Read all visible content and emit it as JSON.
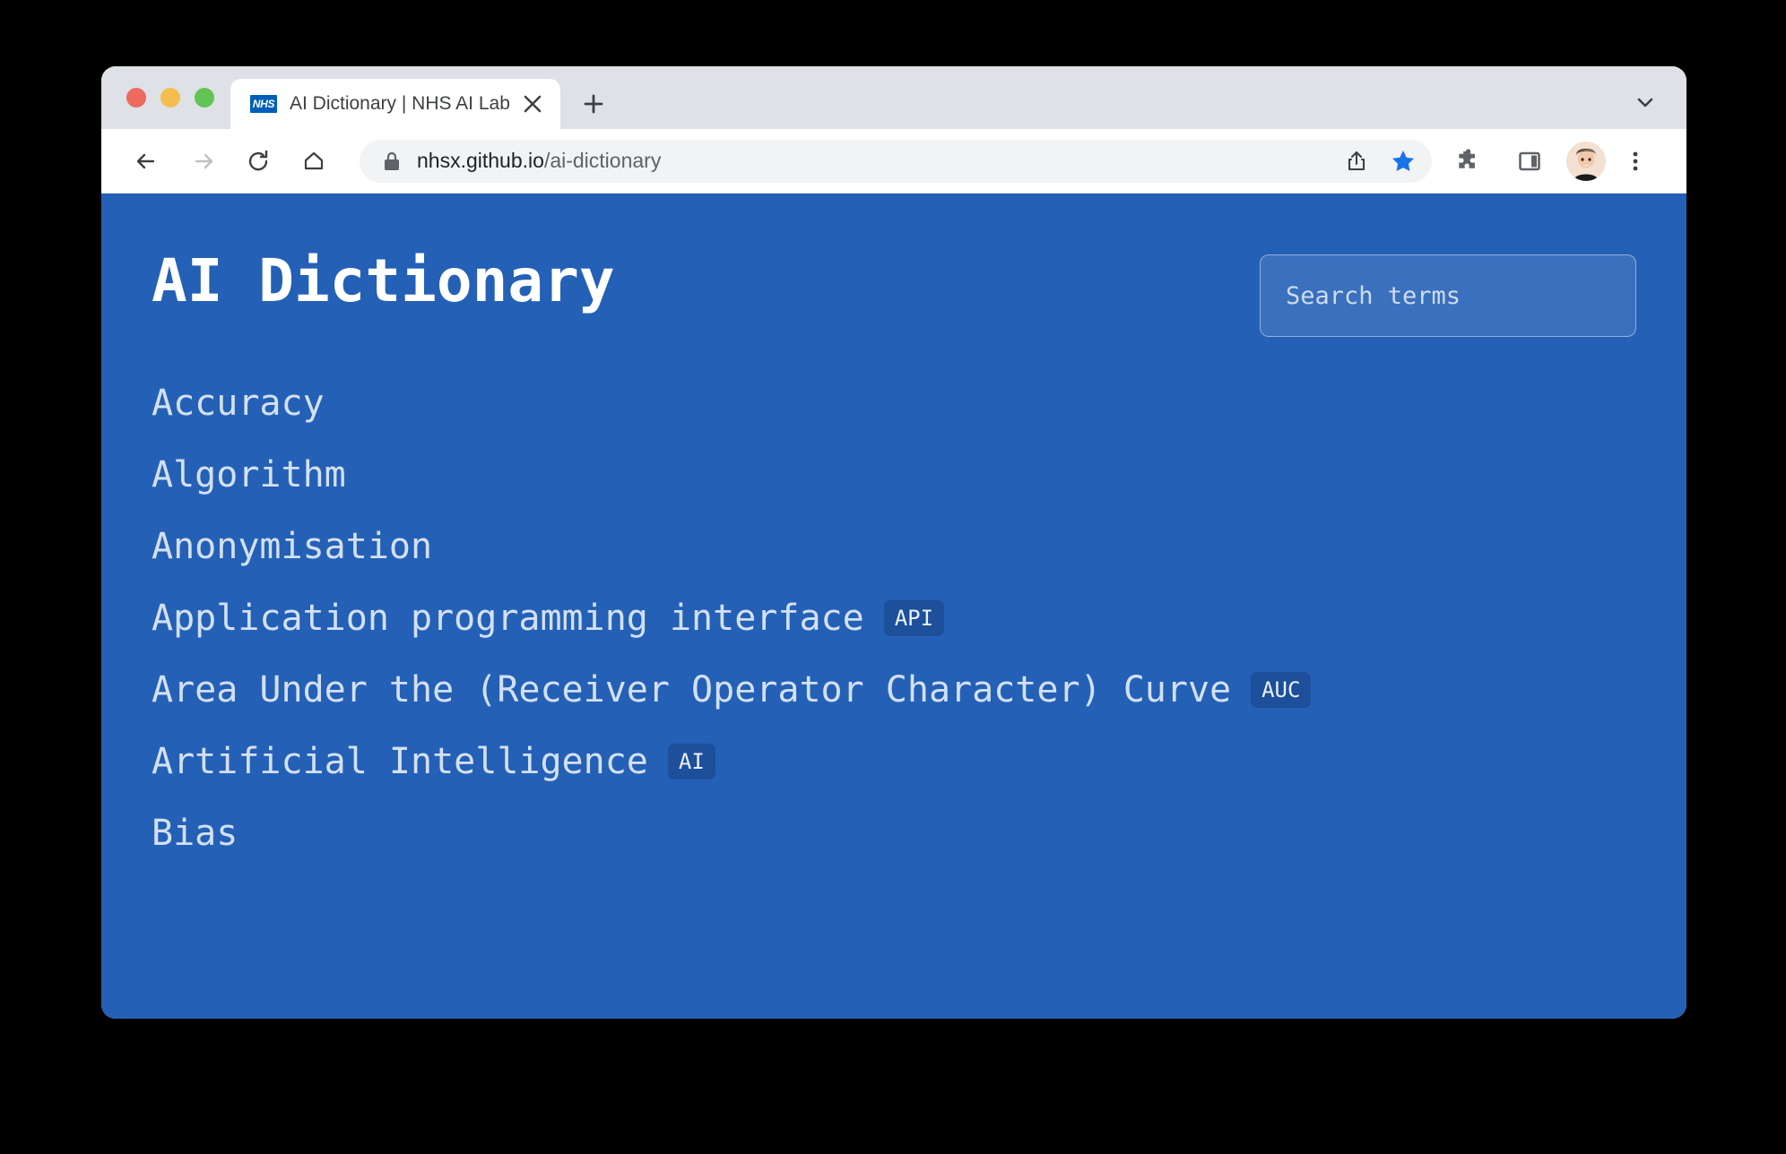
{
  "browser": {
    "window_controls": [
      "close",
      "minimize",
      "maximize"
    ],
    "tab": {
      "title": "AI Dictionary | NHS AI Lab",
      "favicon_text": "NHS",
      "favicon_color": "#005eb8",
      "close_label": "✕"
    },
    "new_tab_label": "+",
    "tab_search_label": "⌄",
    "toolbar": {
      "back_label": "←",
      "forward_label": "→",
      "reload_label": "⟳",
      "home_label": "⌂",
      "url_domain": "nhsx.github.io",
      "url_path": "/ai-dictionary",
      "share_label": "share-icon",
      "bookmark_label": "bookmark-star-icon",
      "bookmark_color": "#1a73e8",
      "extensions_label": "puzzle-icon",
      "side_panel_label": "side-panel-icon",
      "profile_label": "profile-avatar",
      "menu_label": "⋮"
    }
  },
  "page": {
    "background_color": "#2460b6",
    "title": "AI Dictionary",
    "search": {
      "placeholder": "Search terms",
      "value": ""
    },
    "terms": [
      {
        "label": "Accuracy",
        "abbr": ""
      },
      {
        "label": "Algorithm",
        "abbr": ""
      },
      {
        "label": "Anonymisation",
        "abbr": ""
      },
      {
        "label": "Application programming interface",
        "abbr": "API"
      },
      {
        "label": "Area Under the (Receiver Operator Character) Curve",
        "abbr": "AUC"
      },
      {
        "label": "Artificial Intelligence",
        "abbr": "AI"
      },
      {
        "label": "Bias",
        "abbr": ""
      }
    ]
  }
}
